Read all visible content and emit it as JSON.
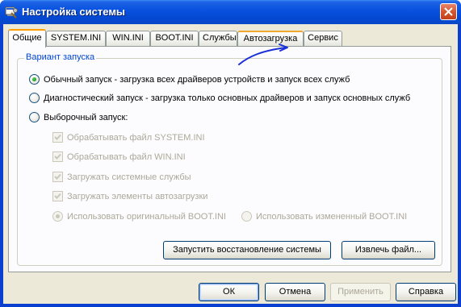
{
  "window": {
    "title": "Настройка системы",
    "colors": {
      "titlebar": "#0a53e0",
      "client": "#ece9d8",
      "tab_accent": "#ff9c00",
      "legend": "#0046d5"
    }
  },
  "tabs": [
    {
      "label": "Общие",
      "active": true
    },
    {
      "label": "SYSTEM.INI"
    },
    {
      "label": "WIN.INI"
    },
    {
      "label": "BOOT.INI"
    },
    {
      "label": "Службы"
    },
    {
      "label": "Автозагрузка"
    },
    {
      "label": "Сервис"
    }
  ],
  "group": {
    "legend": "Вариант запуска",
    "options": [
      {
        "label": "Обычный запуск - загрузка всех драйверов устройств и запуск всех служб",
        "checked": true
      },
      {
        "label": "Диагностический запуск - загрузка только основных драйверов и запуск основных служб",
        "checked": false
      },
      {
        "label": "Выборочный запуск:",
        "checked": false
      }
    ],
    "selective": {
      "checkboxes": [
        {
          "label": "Обрабатывать файл SYSTEM.INI",
          "checked": true
        },
        {
          "label": "Обрабатывать файл WIN.INI",
          "checked": true
        },
        {
          "label": "Загружать системные службы",
          "checked": true
        },
        {
          "label": "Загружать элементы автозагрузки",
          "checked": true
        }
      ],
      "boot_original": "Использовать оригинальный  BOOT.INI",
      "boot_modified": "Использовать измененный BOOT.INI"
    },
    "restore_button": "Запустить восстановление системы",
    "extract_button": "Извлечь файл..."
  },
  "footer": {
    "ok": "ОК",
    "cancel": "Отмена",
    "apply": "Применить",
    "help": "Справка"
  }
}
